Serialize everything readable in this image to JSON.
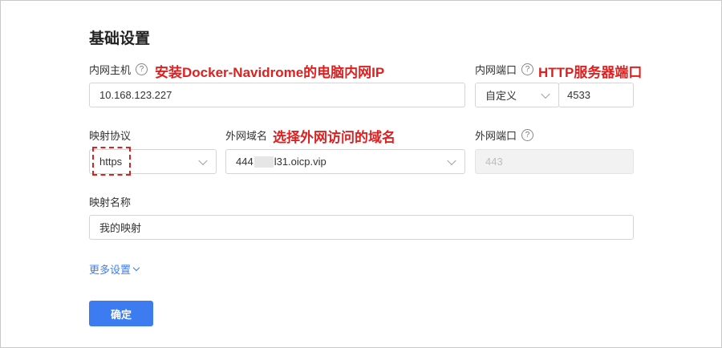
{
  "section_title": "基础设置",
  "fields": {
    "lan_host": {
      "label": "内网主机",
      "help_icon": "?",
      "value": "10.168.123.227"
    },
    "lan_port": {
      "label": "内网端口",
      "help_icon": "?",
      "select_value": "自定义",
      "value": "4533"
    },
    "protocol": {
      "label": "映射协议",
      "value": "https"
    },
    "wan_domain": {
      "label": "外网域名",
      "value_prefix": "444",
      "value_suffix": "l31.oicp.vip"
    },
    "wan_port": {
      "label": "外网端口",
      "help_icon": "?",
      "placeholder": "443"
    },
    "mapping_name": {
      "label": "映射名称",
      "value": "我的映射"
    }
  },
  "annotations": {
    "lan_host": "安装Docker-Navidrome的电脑内网IP",
    "lan_port": "HTTP服务器端口",
    "wan_domain": "选择外网访问的域名"
  },
  "more_settings": "更多设置",
  "confirm_button": "确定",
  "colors": {
    "accent": "#3d7cf0",
    "annotation": "#e02020"
  }
}
